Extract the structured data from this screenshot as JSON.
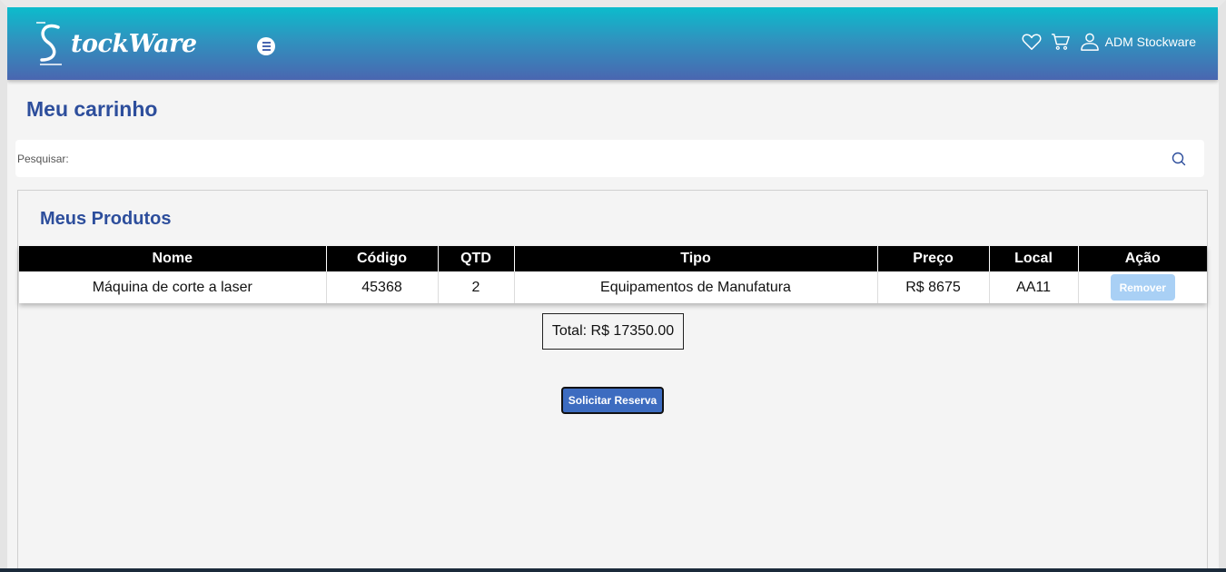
{
  "header": {
    "logo_text": "tockWare",
    "user_name": "ADM Stockware"
  },
  "page": {
    "title": "Meu carrinho"
  },
  "search": {
    "label": "Pesquisar:",
    "value": ""
  },
  "products": {
    "title": "Meus Produtos",
    "columns": [
      "Nome",
      "Código",
      "QTD",
      "Tipo",
      "Preço",
      "Local",
      "Ação"
    ],
    "rows": [
      {
        "nome": "Máquina de corte a laser",
        "codigo": "45368",
        "qtd": "2",
        "tipo": "Equipamentos de Manufatura",
        "preco": "R$ 8675",
        "local": "AA11",
        "acao": "Remover"
      }
    ]
  },
  "total": "Total: R$ 17350.00",
  "reserve_button": "Solicitar Reserva",
  "colors": {
    "header_gradient_top": "#0cbccc",
    "header_gradient_bottom": "#4a66b0",
    "title_blue": "#2d4e9c",
    "remove_button": "#a9d0f5",
    "reserve_button": "#3d6cc0"
  },
  "icons": [
    "menu-icon",
    "heart-icon",
    "cart-icon",
    "user-icon",
    "search-icon"
  ]
}
